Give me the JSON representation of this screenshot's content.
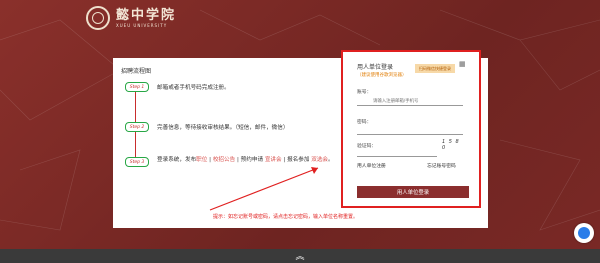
{
  "logo": {
    "name_cn": "懿中学院",
    "name_en": "XUEU UNIVERSITY"
  },
  "left": {
    "title": "招聘流程图",
    "steps": [
      {
        "badge": "Step 1",
        "text": "邮箱或者手机号码完成注册。"
      },
      {
        "badge": "Step 2",
        "text": "完善信息，等待接收审核结果。（短信，邮件，微信）"
      },
      {
        "badge": "Step 3",
        "text_pre": "登录系统，发布",
        "hl1": "职位",
        "mid1": " | ",
        "hl2": "校招公告",
        "mid2": " | 预约申请 ",
        "hl3": "宣讲会",
        "mid3": " | 报名参加 ",
        "hl4": "双选会",
        "tail": "。"
      }
    ],
    "hint": "提示：如忘记账号或密码，请点击忘记密码，输入单位名称重置。"
  },
  "login": {
    "title": "用人单位登录",
    "subtitle": "（建议使用谷歌浏览器）",
    "tag": "扫码微信快捷登录",
    "account_label": "账号：",
    "account_placeholder": "请输入注册邮箱/手机号",
    "password_label": "密码：",
    "captcha_label": "验证码：",
    "captcha_value": "1 5 8 0",
    "register": "用人单位注册",
    "forgot": "忘记账号密码",
    "submit": "用人单位登录"
  },
  "footer": {
    "up_icon": "double-chevron-up-icon"
  },
  "colors": {
    "brand": "#7a2a26",
    "accent": "#e02020",
    "button": "#8b2e2e"
  }
}
